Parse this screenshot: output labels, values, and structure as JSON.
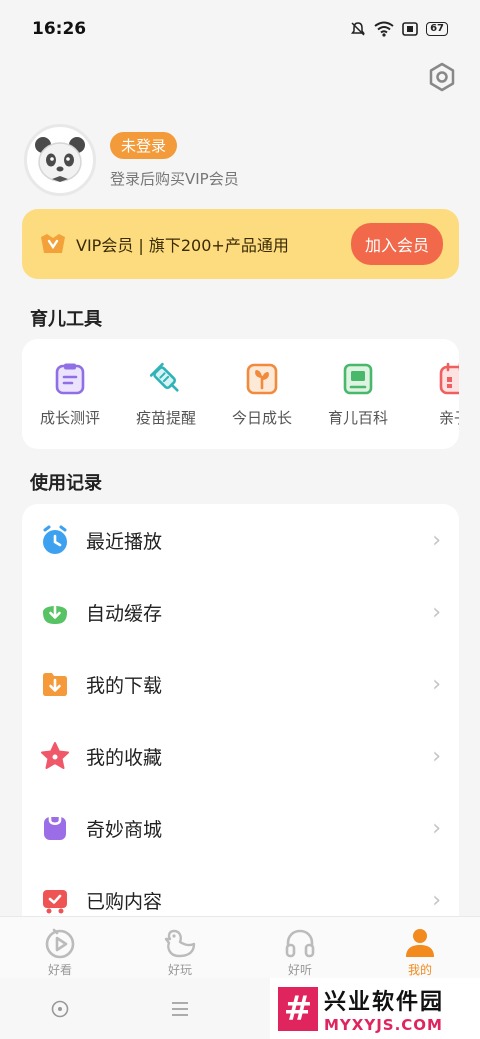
{
  "status_bar": {
    "time": "16:26",
    "battery": "67"
  },
  "profile": {
    "login_badge": "未登录",
    "hint": "登录后购买VIP会员"
  },
  "vip_banner": {
    "text": "VIP会员 | 旗下200+产品通用",
    "button": "加入会员"
  },
  "tools": {
    "title": "育儿工具",
    "items": [
      {
        "label": "成长测评",
        "icon": "clipboard-icon",
        "color": "#8f6ee6"
      },
      {
        "label": "疫苗提醒",
        "icon": "syringe-icon",
        "color": "#2fb3b8"
      },
      {
        "label": "今日成长",
        "icon": "sprout-icon",
        "color": "#f28a3c"
      },
      {
        "label": "育儿百科",
        "icon": "book-icon",
        "color": "#49b86a"
      },
      {
        "label": "亲子",
        "icon": "calendar-icon",
        "color": "#ef5f5f"
      }
    ]
  },
  "records": {
    "title": "使用记录",
    "items": [
      {
        "label": "最近播放",
        "icon": "clock-icon",
        "color": "#3ea1f0"
      },
      {
        "label": "自动缓存",
        "icon": "cache-download-icon",
        "color": "#57c365"
      },
      {
        "label": "我的下载",
        "icon": "folder-download-icon",
        "color": "#f59a3b"
      },
      {
        "label": "我的收藏",
        "icon": "star-icon",
        "color": "#f0586a"
      },
      {
        "label": "奇妙商城",
        "icon": "shopping-bag-icon",
        "color": "#9b6ee8"
      },
      {
        "label": "已购内容",
        "icon": "cart-icon",
        "color": "#ef5454"
      }
    ]
  },
  "tab_bar": {
    "items": [
      {
        "label": "好看",
        "icon": "play-icon"
      },
      {
        "label": "好玩",
        "icon": "duck-icon"
      },
      {
        "label": "好听",
        "icon": "headphones-icon"
      },
      {
        "label": "我的",
        "icon": "person-icon"
      }
    ],
    "active_color": "#f28a1e"
  },
  "watermark": {
    "cn": "兴业软件园",
    "en": "MYXYJS.COM",
    "mark": "#"
  }
}
